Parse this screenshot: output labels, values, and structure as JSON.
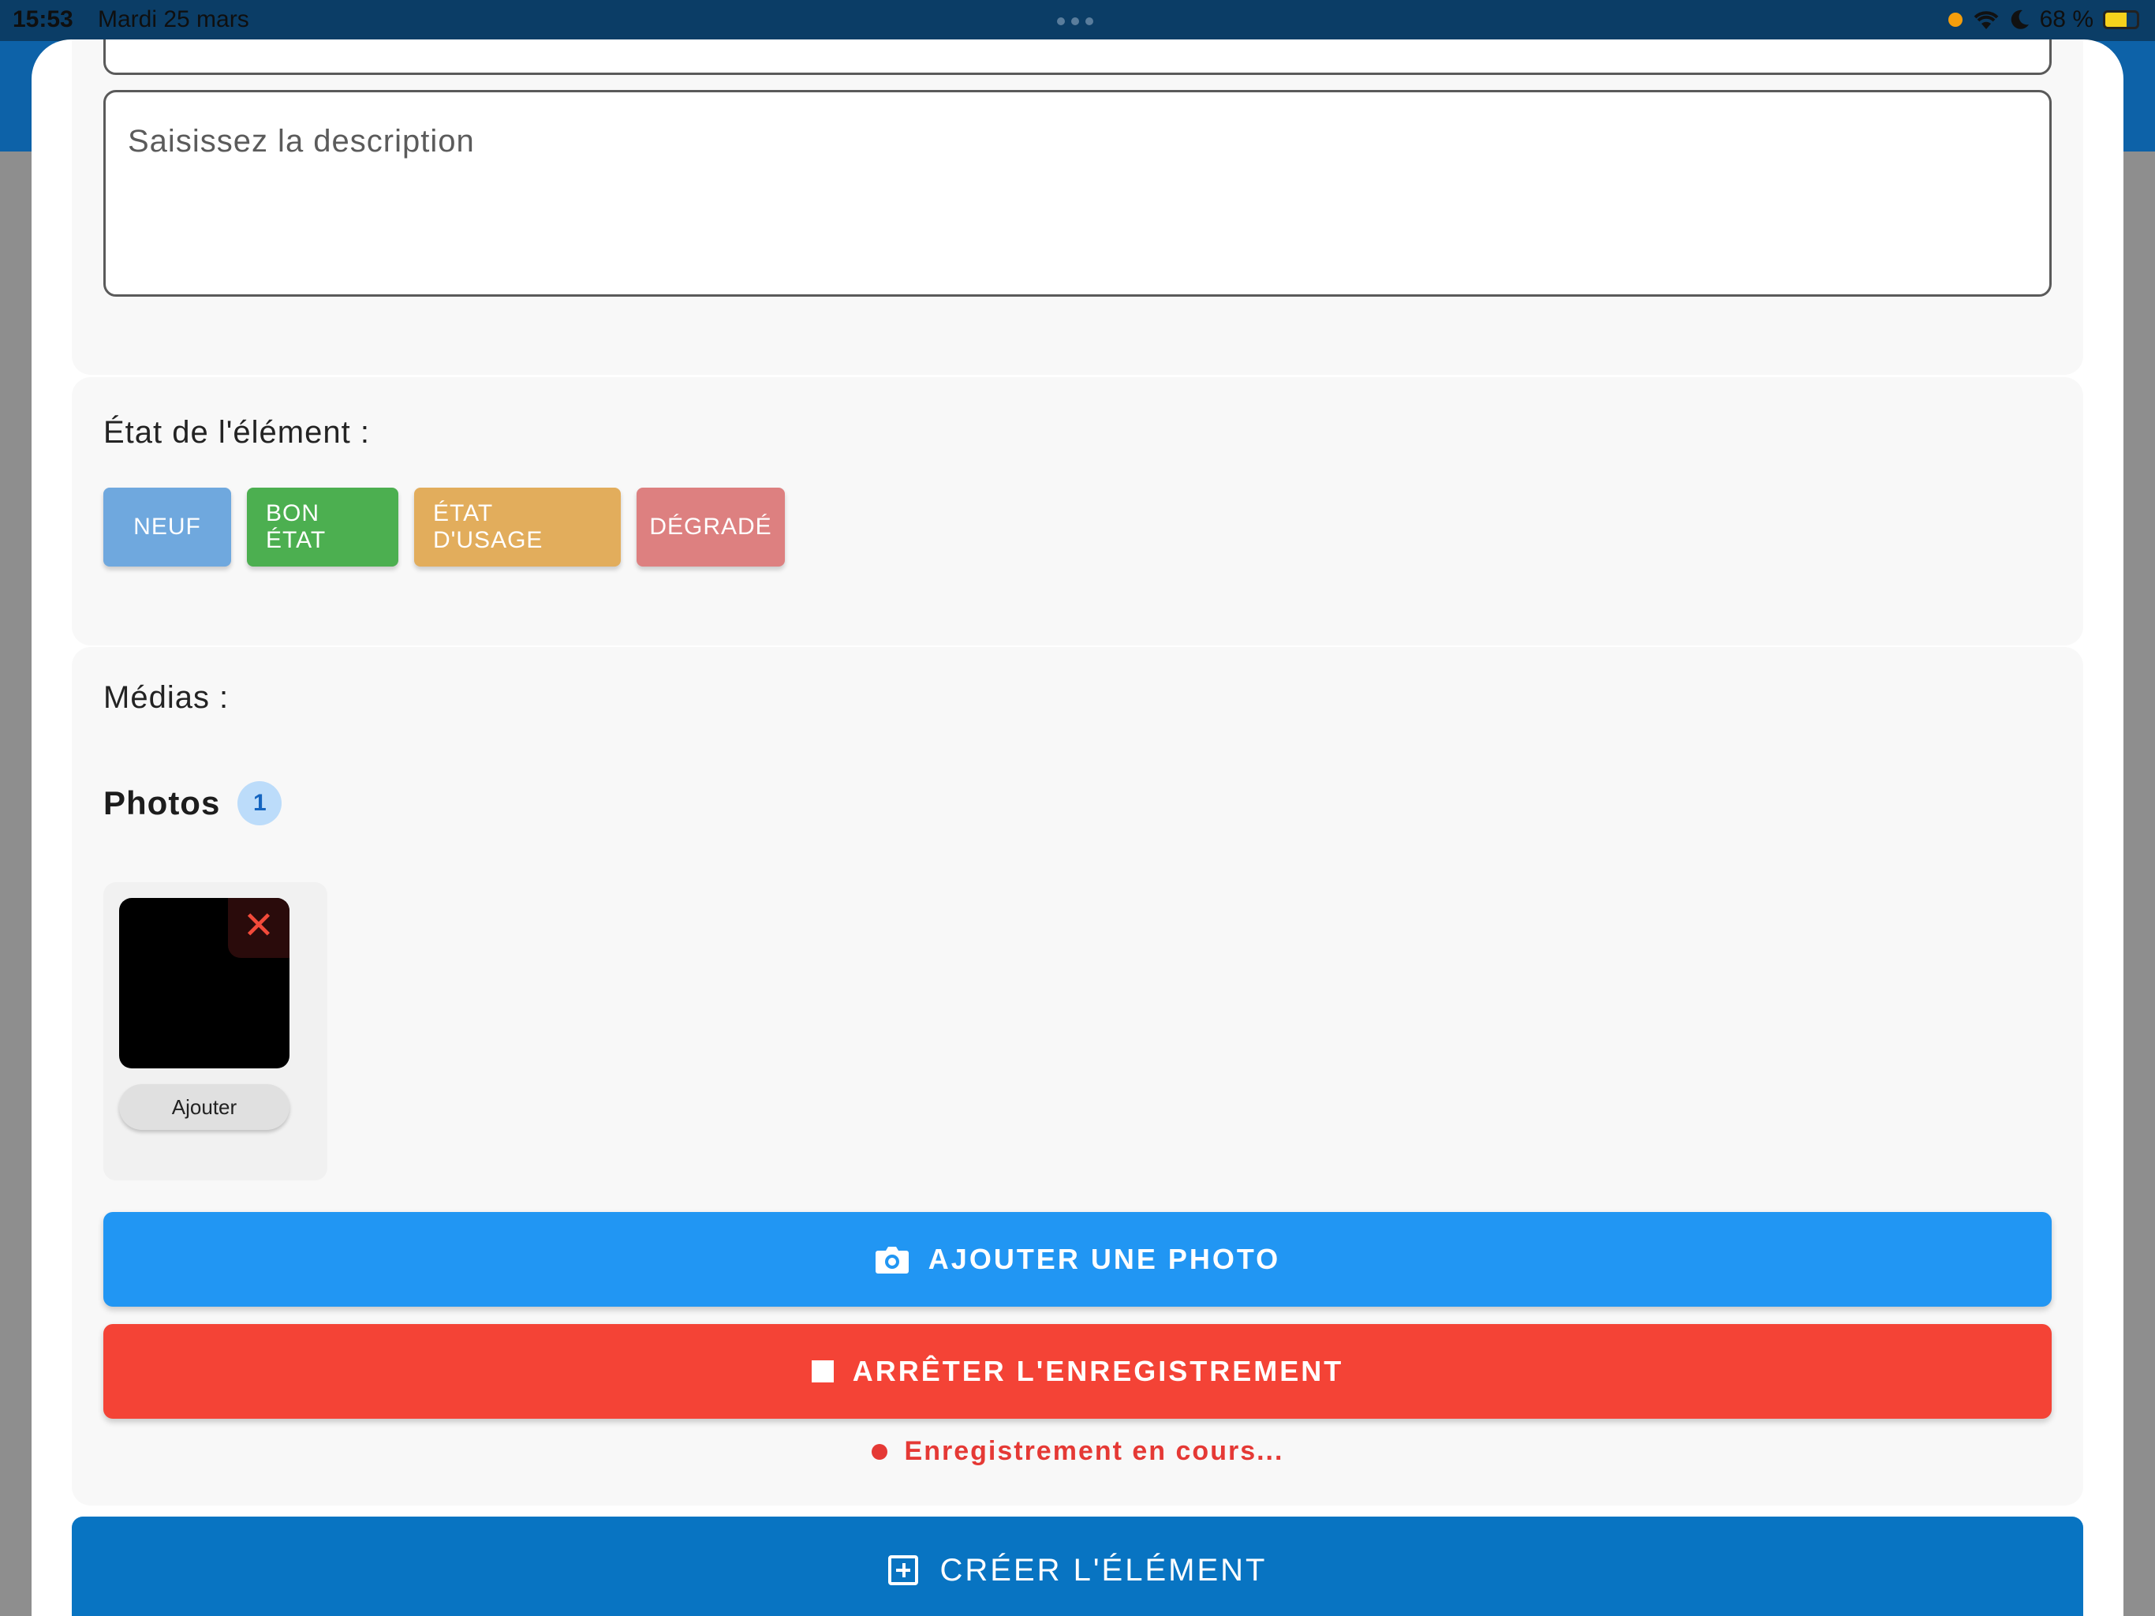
{
  "status_bar": {
    "time": "15:53",
    "date": "Mardi 25 mars",
    "battery": "68 %"
  },
  "form": {
    "description_placeholder": "Saisissez la description",
    "state": {
      "label": "État de l'élément :",
      "options": [
        "NEUF",
        "BON ÉTAT",
        "ÉTAT D'USAGE",
        "DÉGRADÉ"
      ],
      "colors": [
        "#6fa8de",
        "#4caf50",
        "#e2ad5c",
        "#dd8080"
      ]
    },
    "media": {
      "label": "Médias :",
      "photos_title": "Photos",
      "photos_count": "1",
      "thumbnail_add_label": "Ajouter",
      "add_photo_button": "AJOUTER UNE PHOTO",
      "stop_recording_button": "ARRÊTER L'ENREGISTREMENT",
      "recording_status": "Enregistrement en cours..."
    },
    "create_button": "CRÉER L'ÉLÉMENT"
  },
  "colors": {
    "primary": "#2196f3",
    "danger": "#f44336",
    "create": "#0874c2"
  }
}
